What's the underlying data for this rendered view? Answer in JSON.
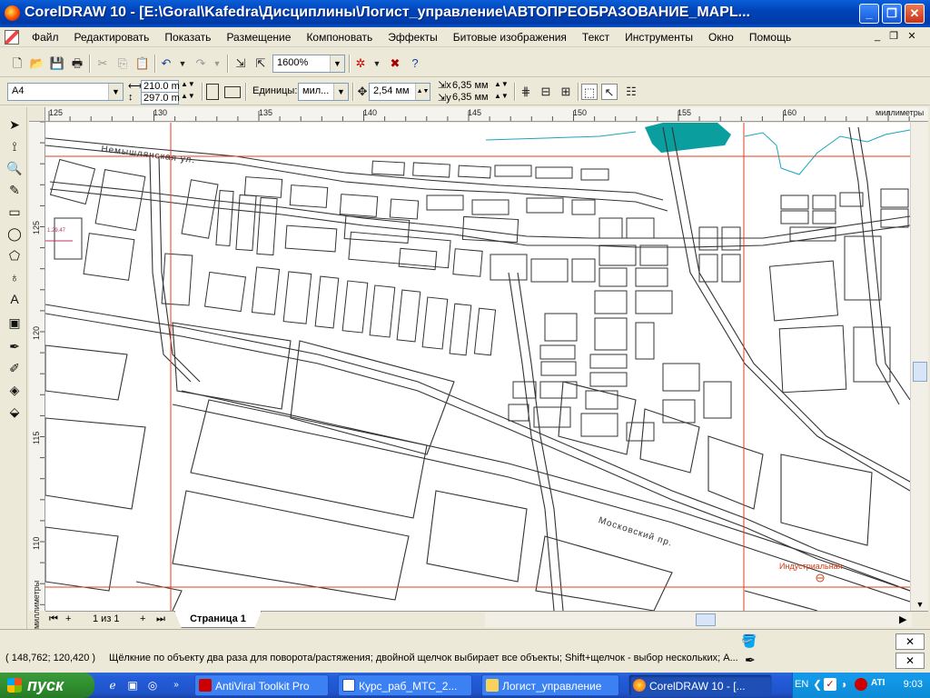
{
  "window": {
    "title": "CorelDRAW 10 - [E:\\Goral\\Kafedra\\Дисциплины\\Логист_управление\\АВТОПРЕОБРАЗОВАНИЕ_MAPL...",
    "minimize": "_",
    "maximize": "❐",
    "close": "✕"
  },
  "menu": {
    "items": [
      "Файл",
      "Редактировать",
      "Показать",
      "Размещение",
      "Компоновать",
      "Эффекты",
      "Битовые изображения",
      "Текст",
      "Инструменты",
      "Окно",
      "Помощь"
    ]
  },
  "toolbar": {
    "zoom_value": "1600%"
  },
  "property_bar": {
    "paper_size": "A4",
    "width": "210.0 m",
    "height": "297.0 m",
    "units_label": "Единицы:",
    "units_value": "мил...",
    "nudge": "2,54 мм",
    "dup_x": "6,35 мм",
    "dup_y": "6,35 мм"
  },
  "ruler": {
    "unit_label": "миллиметры",
    "h_ticks": [
      "125",
      "130",
      "135",
      "140",
      "145",
      "150",
      "155",
      "160"
    ],
    "v_ticks": [
      "125",
      "120",
      "115",
      "110"
    ]
  },
  "map_labels": {
    "street_top": "Немышлянская ул.",
    "street_main": "Московский пр.",
    "station": "Индустриальная",
    "marker": "1.29.47"
  },
  "page_nav": {
    "counter": "1 из 1",
    "tab": "Страница 1"
  },
  "status": {
    "coords": "( 148,762; 120,420 )",
    "hint": "Щёлкние по объекту два раза для поворота/растяжения; двойной щелчок выбирает все объекты; Shift+щелчок - выбор нескольких; А..."
  },
  "taskbar": {
    "start": "пуск",
    "tasks": [
      "AntiViral Toolkit Pro",
      "Курс_раб_МТС_2...",
      "Логист_управление",
      "CorelDRAW 10 - [..."
    ],
    "lang": "EN",
    "clock": "9:03"
  }
}
